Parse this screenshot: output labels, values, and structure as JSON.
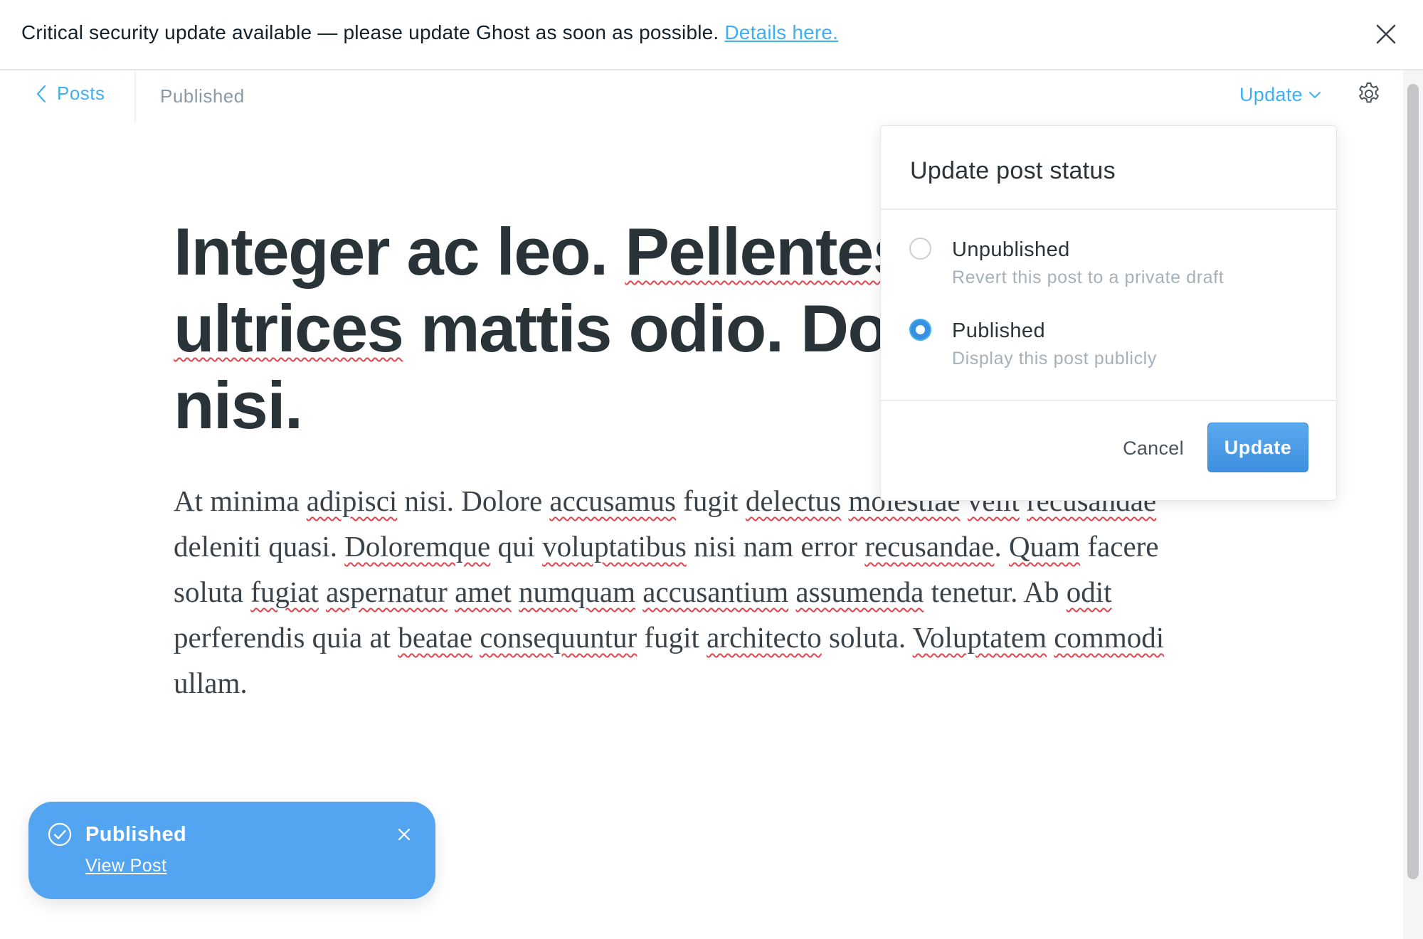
{
  "alert": {
    "message": "Critical security update available — please update Ghost as soon as possible.",
    "link_label": "Details here.",
    "close_icon": "close-icon"
  },
  "nav": {
    "back_label": "Posts",
    "back_icon": "chevron-left-icon",
    "status": "Published",
    "update_label": "Update",
    "update_icon": "chevron-down-icon",
    "settings_icon": "gear-icon"
  },
  "post": {
    "title_parts": [
      "Integer ac leo. ",
      "Pellentesque",
      " ",
      "ultrices",
      " mattis odio. Donec vitae nisi."
    ],
    "body_parts": [
      "At minima ",
      "adipisci",
      " nisi. Dolore ",
      "accusamus",
      " fugit ",
      "delectus",
      " ",
      "molestiae",
      " ",
      "velit",
      " ",
      "recusandae",
      " deleniti quasi. ",
      "Doloremque",
      " qui ",
      "voluptatibus",
      " nisi nam error ",
      "recusandae",
      ". ",
      "Quam",
      " facere soluta ",
      "fugiat",
      " ",
      "aspernatur",
      " ",
      "amet",
      " ",
      "numquam",
      " ",
      "accusantium",
      " ",
      "assumenda",
      " tenetur. Ab ",
      "odit",
      " perferendis quia at ",
      "beatae",
      " ",
      "consequuntur",
      " fugit ",
      "architecto",
      " soluta. ",
      "Voluptatem",
      " ",
      "commodi",
      " ullam."
    ]
  },
  "popover": {
    "title": "Update post status",
    "options": [
      {
        "label": "Unpublished",
        "description": "Revert this post to a private draft",
        "selected": false
      },
      {
        "label": "Published",
        "description": "Display this post publicly",
        "selected": true
      }
    ],
    "cancel_label": "Cancel",
    "update_label": "Update"
  },
  "toast": {
    "title": "Published",
    "link_label": "View Post",
    "icon": "check-circle-icon",
    "close_icon": "close-icon"
  },
  "colors": {
    "accent": "#3eb0ef",
    "toast_bg": "#53a5f2",
    "title_text": "#2a3338",
    "spellcheck": "#e2444c"
  }
}
